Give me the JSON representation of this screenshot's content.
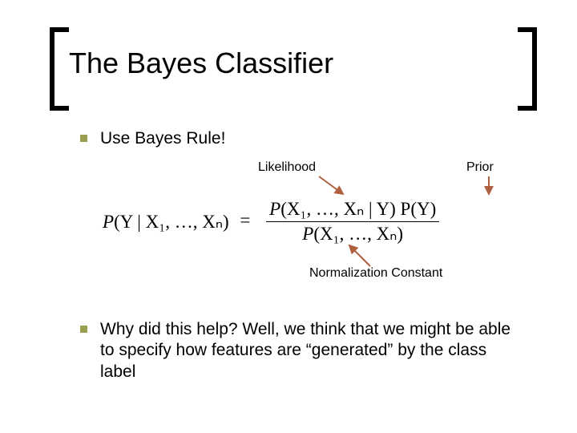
{
  "title": "The Bayes Classifier",
  "bullets": {
    "b1": "Use Bayes Rule!",
    "b2": "Why did this help?  Well, we think that we might be able to specify how features are “generated” by the class label"
  },
  "annotations": {
    "likelihood": "Likelihood",
    "prior": "Prior",
    "normconst": "Normalization Constant"
  },
  "formula": {
    "lhs_open": "P",
    "lhs_inner": "(Y | X₁, …, Xₙ)",
    "eq": "=",
    "num_p": "P",
    "num_inner": "(X₁, …, Xₙ | Y) P(Y)",
    "den_p": "P",
    "den_inner": "(X₁, …, Xₙ)"
  }
}
